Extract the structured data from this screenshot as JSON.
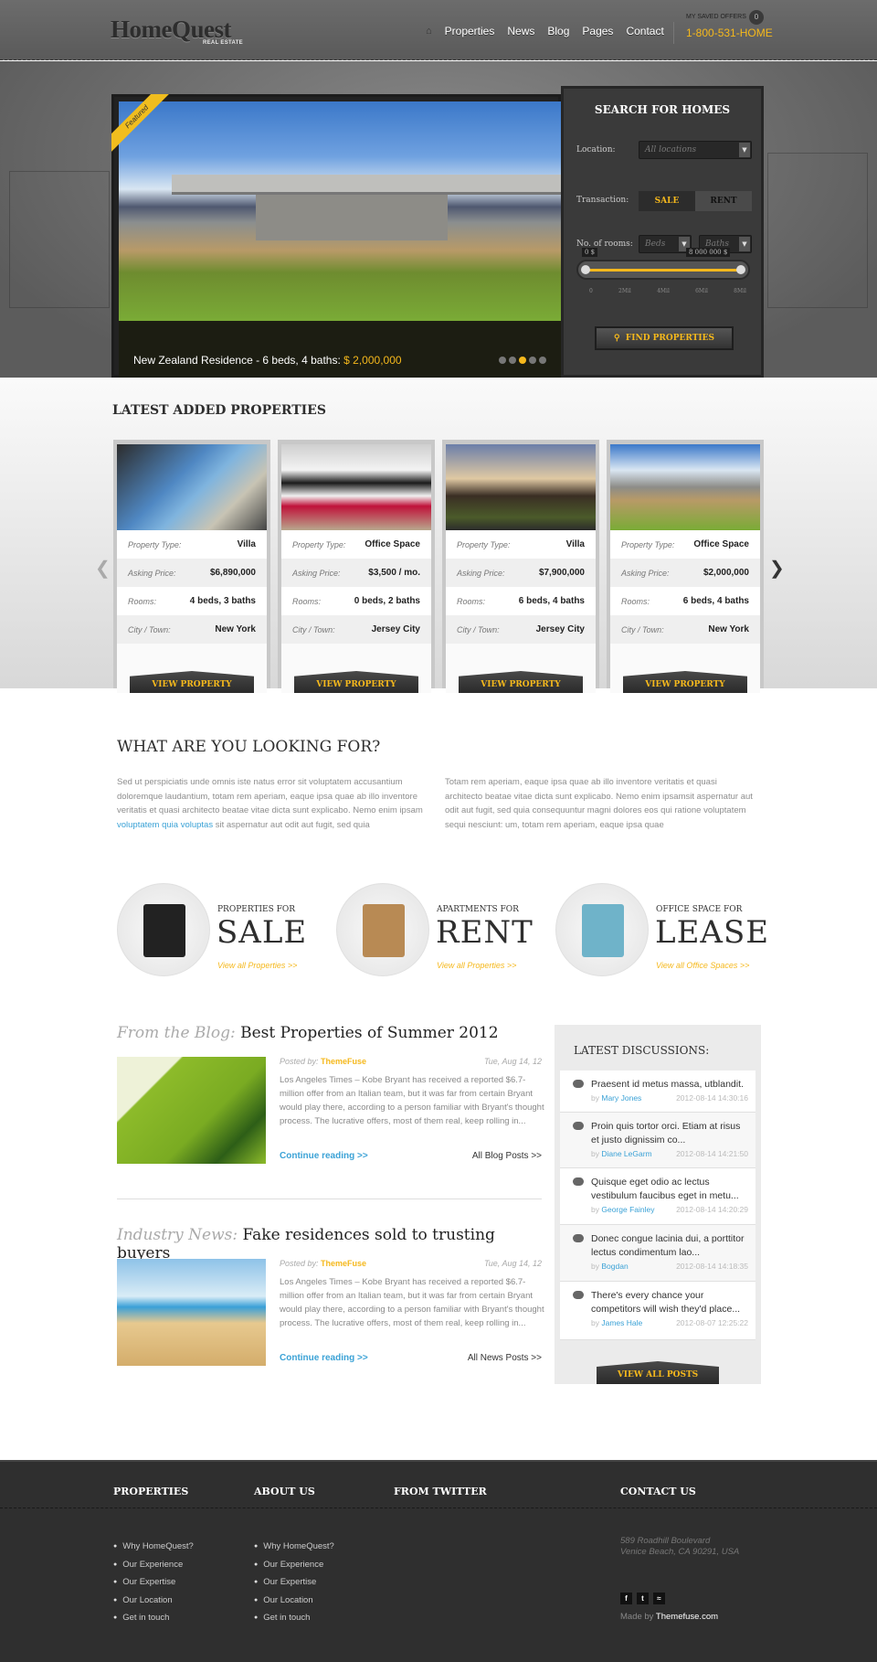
{
  "header": {
    "logo": "HomeQuest",
    "logo_sub": "REAL ESTATE",
    "nav": [
      "Properties",
      "News",
      "Blog",
      "Pages",
      "Contact"
    ],
    "home_icon": "home-icon",
    "saved_offers_label": "MY SAVED OFFERS",
    "saved_offers_count": "0",
    "phone": "1-800-531-HOME",
    "accent_color": "#f5b81c"
  },
  "hero": {
    "ribbon": "Featured",
    "caption_text": "New Zealand Residence - 6 beds, 4 baths:",
    "caption_price": "$ 2,000,000",
    "slide_count": 5,
    "active_slide": 3,
    "search": {
      "title": "SEARCH FOR HOMES",
      "location_label": "Location:",
      "location_value": "All locations",
      "transaction_label": "Transaction:",
      "transaction_options": [
        "SALE",
        "RENT"
      ],
      "transaction_selected": "SALE",
      "rooms_label": "No. of rooms:",
      "beds_placeholder": "Beds",
      "baths_placeholder": "Baths",
      "price_min_tag": "0 $",
      "price_max_tag": "8 000 000 $",
      "price_range_fraction": [
        0,
        1
      ],
      "ticks": [
        "0",
        "2Mil",
        "4Mil",
        "6Mil",
        "8Mil"
      ],
      "button": "FIND PROPERTIES"
    }
  },
  "latest": {
    "title": "LATEST ADDED PROPERTIES",
    "labels": {
      "type": "Property Type:",
      "price": "Asking Price:",
      "rooms": "Rooms:",
      "city": "City / Town:"
    },
    "button": "VIEW PROPERTY",
    "cards": [
      {
        "type": "Villa",
        "price": "$6,890,000",
        "rooms": "4 beds, 3 baths",
        "city": "New York"
      },
      {
        "type": "Office Space",
        "price": "$3,500 / mo.",
        "rooms": "0 beds, 2 baths",
        "city": "Jersey City"
      },
      {
        "type": "Villa",
        "price": "$7,900,000",
        "rooms": "6 beds, 4 baths",
        "city": "Jersey City"
      },
      {
        "type": "Office Space",
        "price": "$2,000,000",
        "rooms": "6 beds, 4 baths",
        "city": "New York"
      }
    ]
  },
  "looking": {
    "title": "WHAT ARE YOU LOOKING FOR?",
    "para1_before": "Sed ut perspiciatis unde omnis iste natus error sit voluptatem accusantium doloremque laudantium, totam rem aperiam, eaque ipsa quae ab illo inventore veritatis et quasi architecto beatae vitae dicta sunt explicabo. Nemo enim ipsam ",
    "para1_link": "voluptatem quia voluptas",
    "para1_after": " sit aspernatur aut odit aut fugit, sed quia",
    "para2": "Totam rem aperiam, eaque ipsa quae ab illo inventore veritatis et quasi architecto beatae vitae dicta sunt explicabo. Nemo enim ipsamsit aspernatur aut odit aut fugit, sed quia consequuntur magni dolores eos qui ratione voluptatem sequi nesciunt: um, totam rem aperiam, eaque ipsa quae"
  },
  "categories": [
    {
      "small": "PROPERTIES FOR",
      "big": "SALE",
      "link": "View all Properties >>",
      "icon": "house-icon"
    },
    {
      "small": "APARTMENTS FOR",
      "big": "RENT",
      "link": "View all Properties >>",
      "icon": "apartment-icon"
    },
    {
      "small": "OFFICE SPACE FOR",
      "big": "LEASE",
      "link": "View all Office Spaces >>",
      "icon": "office-building-icon"
    }
  ],
  "posts": [
    {
      "prefix": "From the Blog:",
      "title": "Best Properties of Summer 2012",
      "posted_by_label": "Posted by:",
      "author": "ThemeFuse",
      "date": "Tue, Aug 14, 12",
      "body": "Los Angeles Times – Kobe Bryant has received a reported $6.7-million offer from an Italian team, but it was far from certain Bryant would play there, according to a person familiar with Bryant's thought process. The lucrative offers, most of them real, keep rolling in...",
      "continue": "Continue reading >>",
      "all": "All Blog Posts >>"
    },
    {
      "prefix": "Industry News:",
      "title": "Fake residences sold to trusting buyers",
      "posted_by_label": "Posted by:",
      "author": "ThemeFuse",
      "date": "Tue, Aug 14, 12",
      "body": "Los Angeles Times – Kobe Bryant has received a reported $6.7-million offer from an Italian team, but it was far from certain Bryant would play there, according to a person familiar with Bryant's thought process. The lucrative offers, most of them real, keep rolling in...",
      "continue": "Continue reading >>",
      "all": "All News Posts >>"
    }
  ],
  "discussions": {
    "title": "LATEST DISCUSSIONS:",
    "by_label": "by",
    "items": [
      {
        "text": "Praesent id metus massa, utblandit.",
        "author": "Mary Jones",
        "time": "2012-08-14 14:30:16"
      },
      {
        "text": "Proin quis tortor orci. Etiam at risus et justo dignissim co...",
        "author": "Diane LeGarm",
        "time": "2012-08-14 14:21:50"
      },
      {
        "text": "Quisque eget odio ac lectus vestibulum faucibus eget in metu...",
        "author": "George Fainley",
        "time": "2012-08-14 14:20:29"
      },
      {
        "text": "Donec congue lacinia dui, a porttitor lectus condimentum lao...",
        "author": "Bogdan",
        "time": "2012-08-14 14:18:35"
      },
      {
        "text": "There's every chance your competitors will wish they'd place...",
        "author": "James Hale",
        "time": "2012-08-07 12:25:22"
      }
    ],
    "button": "VIEW ALL POSTS"
  },
  "footer": {
    "headings": [
      "PROPERTIES",
      "ABOUT US",
      "FROM TWITTER",
      "CONTACT US"
    ],
    "properties_links": [
      "Why HomeQuest?",
      "Our Experience",
      "Our Expertise",
      "Our Location",
      "Get in touch"
    ],
    "about_links": [
      "Why HomeQuest?",
      "Our Experience",
      "Our Expertise",
      "Our Location",
      "Get in touch"
    ],
    "address_line1": "589 Roadhill Boulevard",
    "address_line2": "Venice Beach, CA 90291, USA",
    "social": [
      "facebook-icon",
      "twitter-icon",
      "rss-icon"
    ],
    "made_by_label": "Made by",
    "made_by_link": "Themefuse.com"
  }
}
